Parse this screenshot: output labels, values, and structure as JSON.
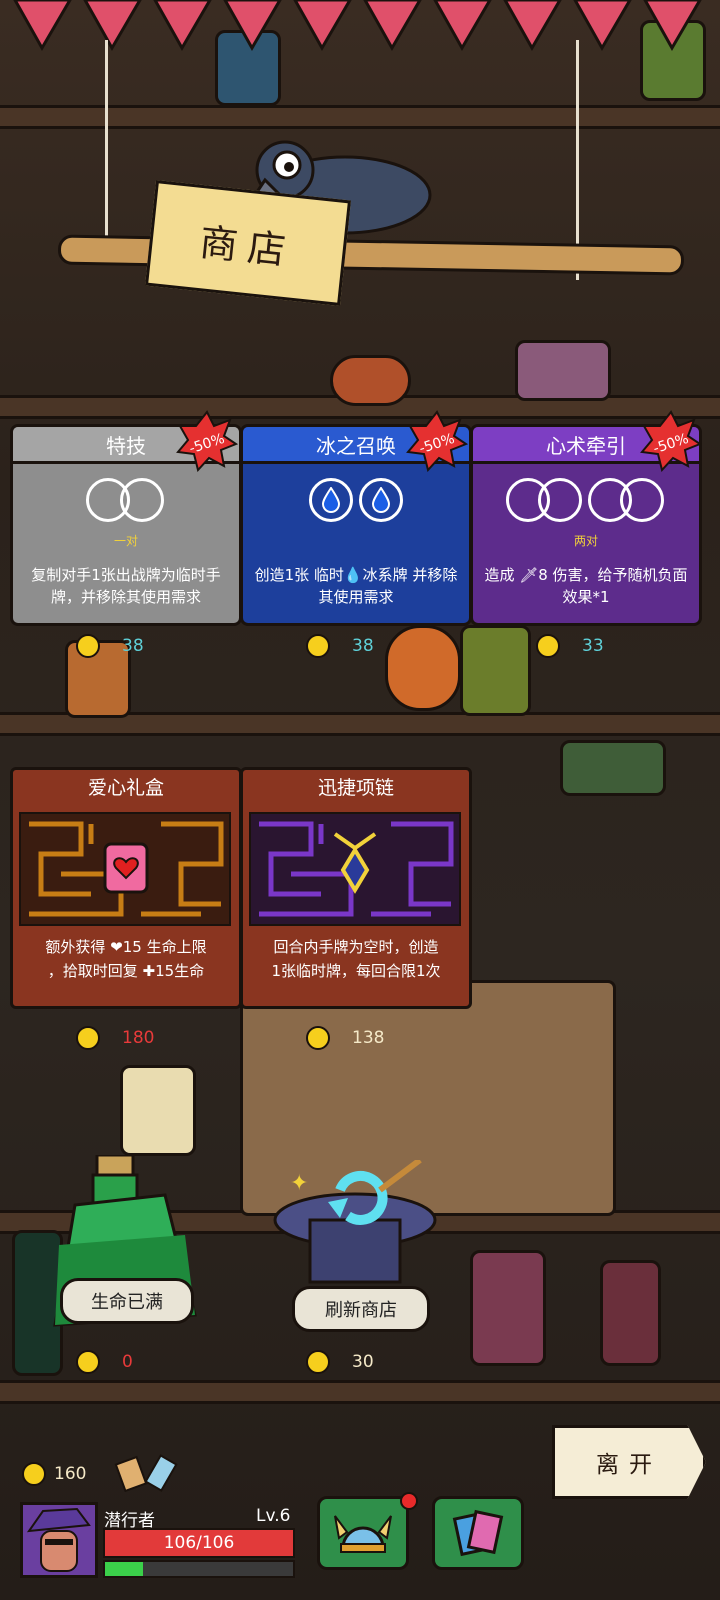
{
  "shop": {
    "title": "商店"
  },
  "cards": [
    {
      "title": "特技",
      "discount": "-50%",
      "subtitle": "一对",
      "description": "复制对手1张出战牌为临时手牌，并移除其使用需求",
      "price": "38",
      "color": "#8e8e8e",
      "head_color": "#9e9e9e"
    },
    {
      "title": "冰之召唤",
      "discount": "-50%",
      "subtitle": "",
      "description": "创造1张 临时💧冰系牌 并移除其使用需求",
      "price": "38",
      "color": "#1d3f9c",
      "head_color": "#2a5ad0"
    },
    {
      "title": "心术牵引",
      "discount": "-50%",
      "subtitle": "两对",
      "description": "造成 🗡8 伤害，给予随机负面效果*1",
      "price": "33",
      "color": "#5d2c8c",
      "head_color": "#7d3ec3"
    }
  ],
  "relics": [
    {
      "title": "爱心礼盒",
      "desc_line1": "额外获得 ❤15 生命上限",
      "desc_line2": "，拾取时回复 ✚15生命",
      "price": "180",
      "maze_color": "#c77d15",
      "icon": "heart-box-icon"
    },
    {
      "title": "迅捷项链",
      "desc_line1": "回合内手牌为空时，创造",
      "desc_line2": "1张临时牌，每回合限1次",
      "price": "138",
      "maze_color": "#7a37c8",
      "icon": "necklace-icon"
    }
  ],
  "services": {
    "heal": {
      "label": "生命已满",
      "price": "0"
    },
    "refresh": {
      "label": "刷新商店",
      "price": "30"
    }
  },
  "leave": {
    "label": "离开"
  },
  "player": {
    "gold": "160",
    "name": "潜行者",
    "level": "Lv.6",
    "hp": "106/106",
    "hp_fraction": 1.0,
    "xp_fraction": 0.2
  }
}
